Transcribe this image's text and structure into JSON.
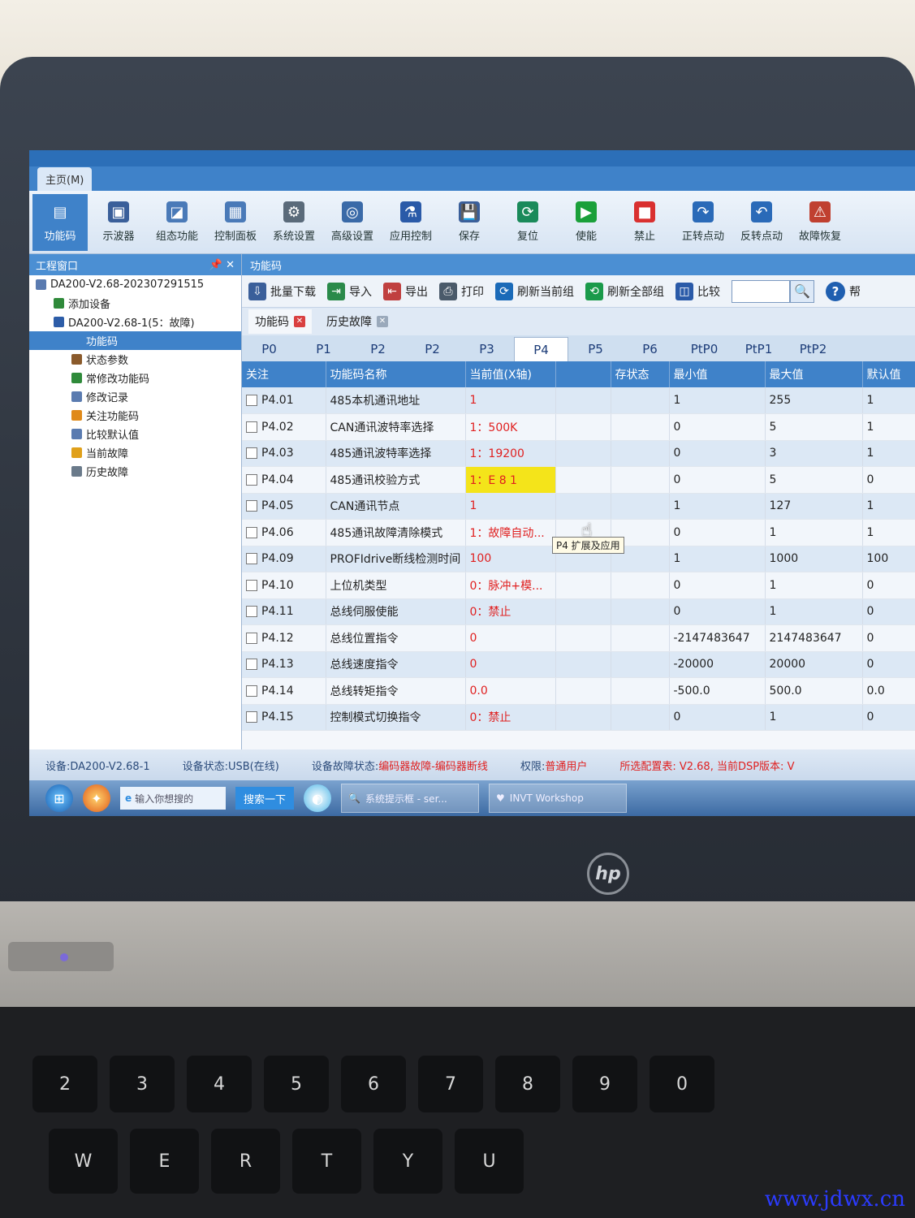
{
  "app": {
    "menu_tab": "主页(M)",
    "ribbon": [
      {
        "label": "功能码",
        "icon": "function-code-icon"
      },
      {
        "label": "示波器",
        "icon": "oscilloscope-icon"
      },
      {
        "label": "组态功能",
        "icon": "configuration-icon"
      },
      {
        "label": "控制面板",
        "icon": "control-panel-icon"
      },
      {
        "label": "系统设置",
        "icon": "gear-icon"
      },
      {
        "label": "高级设置",
        "icon": "advanced-settings-icon"
      },
      {
        "label": "应用控制",
        "icon": "application-control-icon"
      },
      {
        "label": "保存",
        "icon": "save-icon"
      },
      {
        "label": "复位",
        "icon": "reset-icon"
      },
      {
        "label": "使能",
        "icon": "play-icon"
      },
      {
        "label": "禁止",
        "icon": "stop-icon"
      },
      {
        "label": "正转点动",
        "icon": "forward-jog-icon"
      },
      {
        "label": "反转点动",
        "icon": "reverse-jog-icon"
      },
      {
        "label": "故障恢复",
        "icon": "fault-recovery-icon"
      }
    ]
  },
  "left_panel": {
    "title": "工程窗口",
    "pin_icon": "pin-icon",
    "close_icon": "close-icon",
    "tree": [
      {
        "label": "DA200-V2.68-20230729151​5",
        "level": 0,
        "color": "#5a7bb0"
      },
      {
        "label": "添加设备",
        "level": 1,
        "color": "#2f8a3a"
      },
      {
        "label": "DA200-V2.68-1(5：故障)",
        "level": 1,
        "color": "#2d5da8"
      },
      {
        "label": "功能码",
        "level": 2,
        "color": "#3f82c9",
        "selected": true
      },
      {
        "label": "状态参数",
        "level": 2,
        "color": "#8a5a2b"
      },
      {
        "label": "常修改功能码",
        "level": 2,
        "color": "#2f8a3a"
      },
      {
        "label": "修改记录",
        "level": 2,
        "color": "#5a7bb0"
      },
      {
        "label": "关注功能码",
        "level": 2,
        "color": "#e08a1a"
      },
      {
        "label": "比较默认值",
        "level": 2,
        "color": "#5a7bb0"
      },
      {
        "label": "当前故障",
        "level": 2,
        "color": "#e0a01a"
      },
      {
        "label": "历史故障",
        "level": 2,
        "color": "#6a7a8a"
      }
    ]
  },
  "main": {
    "title": "功能码",
    "toolbar": [
      {
        "label": "批量下载",
        "icon": "batch-download-icon"
      },
      {
        "label": "导入",
        "icon": "import-icon"
      },
      {
        "label": "导出",
        "icon": "export-icon"
      },
      {
        "label": "打印",
        "icon": "print-icon"
      },
      {
        "label": "刷新当前组",
        "icon": "refresh-icon"
      },
      {
        "label": "刷新全部组",
        "icon": "refresh-all-icon"
      },
      {
        "label": "比较",
        "icon": "compare-icon"
      }
    ],
    "help_label": "帮",
    "doc_tabs": [
      {
        "label": "功能码"
      },
      {
        "label": "历史故障"
      }
    ],
    "param_tabs": [
      "P0",
      "P1",
      "P2",
      "P2",
      "P3",
      "P4",
      "P5",
      "P6",
      "PtP0",
      "PtP1",
      "PtP2"
    ],
    "active_param_tab": "P4",
    "tooltip": "P4 扩展及应用",
    "columns": [
      "关注",
      "功能码名称",
      "当前值(X轴)",
      "",
      "存状态",
      "最小值",
      "最大值",
      "默认值"
    ],
    "rows": [
      {
        "code": "P4.01",
        "name": "485本机通讯地址",
        "value": "1",
        "min": "1",
        "max": "255",
        "default": "1"
      },
      {
        "code": "P4.02",
        "name": "CAN通讯波特率选择",
        "value": "1：500K",
        "min": "0",
        "max": "5",
        "default": "1"
      },
      {
        "code": "P4.03",
        "name": "485通讯波特率选择",
        "value": "1：19200",
        "min": "0",
        "max": "3",
        "default": "1"
      },
      {
        "code": "P4.04",
        "name": "485通讯校验方式",
        "value": "1：E 8 1",
        "min": "0",
        "max": "5",
        "default": "0",
        "highlight": true
      },
      {
        "code": "P4.05",
        "name": "CAN通讯节点",
        "value": "1",
        "min": "1",
        "max": "127",
        "default": "1"
      },
      {
        "code": "P4.06",
        "name": "485通讯故障清除模式",
        "value": "1：故障自动...",
        "min": "0",
        "max": "1",
        "default": "1"
      },
      {
        "code": "P4.09",
        "name": "PROFIdrive断线检测时间",
        "value": "100",
        "min": "1",
        "max": "1000",
        "default": "100"
      },
      {
        "code": "P4.10",
        "name": "上位机类型",
        "value": "0：脉冲+模...",
        "min": "0",
        "max": "1",
        "default": "0"
      },
      {
        "code": "P4.11",
        "name": "总线伺服使能",
        "value": "0：禁止",
        "min": "0",
        "max": "1",
        "default": "0"
      },
      {
        "code": "P4.12",
        "name": "总线位置指令",
        "value": "0",
        "min": "-2147483647",
        "max": "2147483647",
        "default": "0"
      },
      {
        "code": "P4.13",
        "name": "总线速度指令",
        "value": "0",
        "min": "-20000",
        "max": "20000",
        "default": "0"
      },
      {
        "code": "P4.14",
        "name": "总线转矩指令",
        "value": "0.0",
        "min": "-500.0",
        "max": "500.0",
        "default": "0.0"
      },
      {
        "code": "P4.15",
        "name": "控制模式切换指令",
        "value": "0：禁止",
        "min": "0",
        "max": "1",
        "default": "0"
      }
    ]
  },
  "statusbar": {
    "device": "设备:DA200-V2.68-1",
    "device_state_label": "设备状态:",
    "device_state_value": "USB(在线)",
    "fault_label": "设备故障状态:",
    "fault_value": "编码器故障-编码器断线",
    "permission_label": "权限:",
    "permission_value": "普通用户",
    "config_text": "所选配置表: V2.68, 当前DSP版本: V"
  },
  "taskbar": {
    "search_placeholder": "输入你想搜的",
    "search_button": "搜索一下",
    "item1": "系统提示框 - ser...",
    "item2": "INVT Workshop"
  },
  "keyboard": {
    "row1": [
      "2",
      "3",
      "4",
      "5",
      "6",
      "7",
      "8",
      "9",
      "0"
    ],
    "row2": [
      "W",
      "E",
      "R",
      "T",
      "Y",
      "U"
    ]
  },
  "watermark": "www.jdwx.cn",
  "laptop_brand": "hp"
}
